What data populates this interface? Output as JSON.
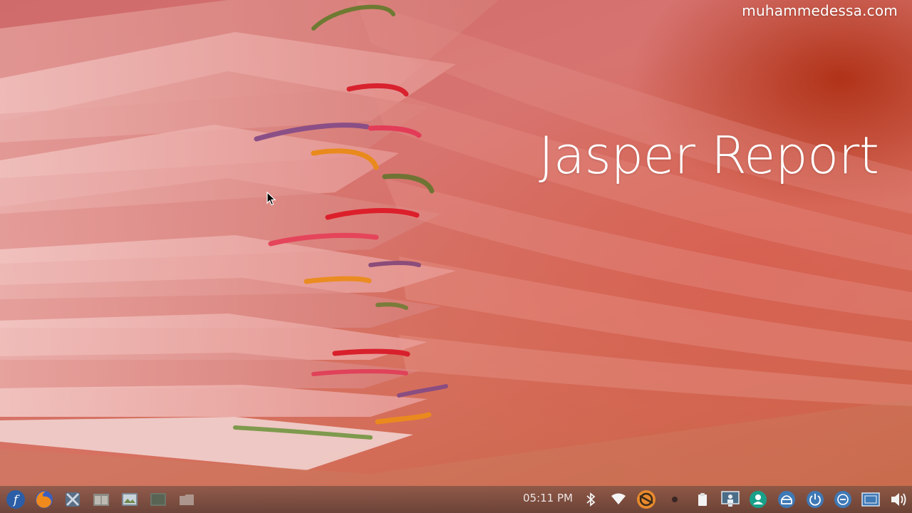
{
  "watermark": "muhammedessa.com",
  "slide": {
    "title": "Jasper Report"
  },
  "taskbar": {
    "clock": "05:11 PM",
    "launchers": [
      {
        "name": "fedora-menu-icon"
      },
      {
        "name": "firefox-icon"
      },
      {
        "name": "system-tools-icon"
      },
      {
        "name": "file-manager-icon"
      },
      {
        "name": "image-viewer-icon"
      },
      {
        "name": "terminal-icon"
      },
      {
        "name": "folder-icon"
      }
    ],
    "tray": [
      {
        "name": "bluetooth-icon"
      },
      {
        "name": "wifi-icon"
      },
      {
        "name": "update-notifier-icon"
      },
      {
        "name": "indicator-dot-icon"
      },
      {
        "name": "clipboard-icon"
      },
      {
        "name": "display-icon"
      },
      {
        "name": "user-icon"
      },
      {
        "name": "lock-icon"
      },
      {
        "name": "power-icon"
      },
      {
        "name": "minimize-icon"
      },
      {
        "name": "screen-icon"
      },
      {
        "name": "volume-icon"
      }
    ]
  },
  "colors": {
    "background_main": "#d77470",
    "background_accent": "#b8431a",
    "text": "#ffffff"
  }
}
